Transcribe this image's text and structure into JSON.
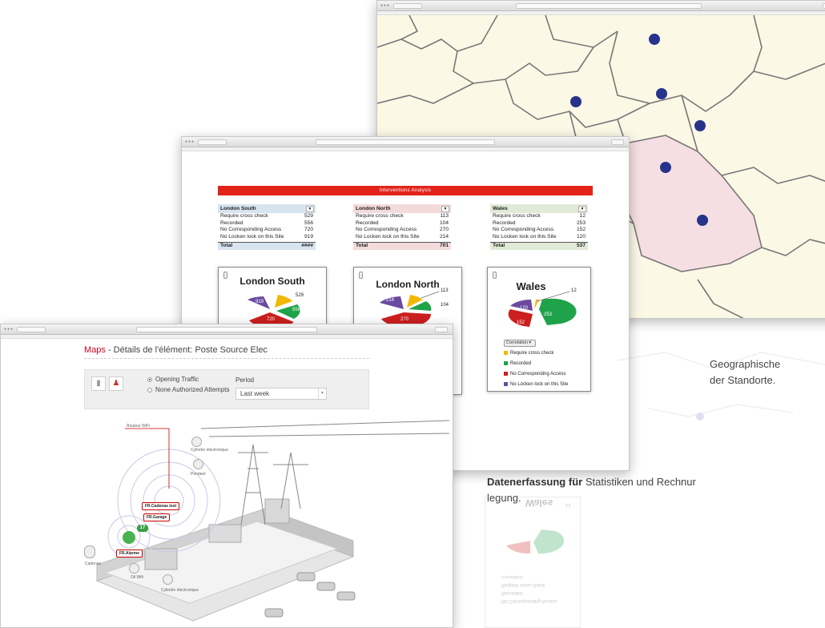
{
  "analysis": {
    "banner": "Interventions Analysis",
    "total_label": "Total",
    "tables": [
      {
        "name": "London South",
        "color": "#d8e4f0",
        "rows": [
          [
            "Require cross check",
            "529"
          ],
          [
            "Recorded",
            "556"
          ],
          [
            "No Corresponding Access",
            "720"
          ],
          [
            "No Locken lock on this Site",
            "919"
          ]
        ],
        "total": "####"
      },
      {
        "name": "London North",
        "color": "#f3dadb",
        "rows": [
          [
            "Require cross check",
            "113"
          ],
          [
            "Recorded",
            "104"
          ],
          [
            "No Corresponding Access",
            "270"
          ],
          [
            "No Locken lock on this Site",
            "214"
          ]
        ],
        "total": "701"
      },
      {
        "name": "Wales",
        "color": "#e1ead6",
        "rows": [
          [
            "Require cross check",
            "12"
          ],
          [
            "Recorded",
            "253"
          ],
          [
            "No Corresponding Access",
            "152"
          ],
          [
            "No Locken lock on this Site",
            "120"
          ]
        ],
        "total": "537"
      }
    ],
    "cards": [
      {
        "title": "London South",
        "labels": [
          "529",
          "556",
          "720",
          "919"
        ]
      },
      {
        "title": "London North",
        "labels": [
          "113",
          "104",
          "270",
          "214"
        ]
      },
      {
        "title": "Wales",
        "labels": [
          "12",
          "253",
          "152",
          "120"
        ]
      }
    ],
    "correlation": "Correlation",
    "legend": [
      {
        "label": "Require cross check",
        "color": "#f2b800"
      },
      {
        "label": "Recorded",
        "color": "#1fa34a"
      },
      {
        "label": "No Corresponding Access",
        "color": "#cc1f1f"
      },
      {
        "label": "No Locken lock on this Site",
        "color": "#6a4ba0"
      }
    ]
  },
  "maps": {
    "title_red": "Maps",
    "title_rest": " - Détails de l'élément: Poste Source Elec",
    "radio1": "Opening Traffic",
    "radio2": "None Authorized Attempts",
    "period_label": "Period",
    "period_value": "Last week",
    "tags": [
      "FR.Cadenas test",
      "FR.Garage",
      "FR.Alarme"
    ],
    "badge": "17",
    "labels": {
      "router": "Routeur WiFi",
      "cyl1": "Cylindre électronique",
      "pendant": "Pendant",
      "cad": "Cadenas",
      "oil": "Oil Wifi",
      "cyl2": "Cylindre électronique"
    }
  },
  "text": {
    "geo1": "Geographische",
    "geo2": "der Standorte.",
    "data_bold": "Datenerfassung für",
    "data_rest": " Statistiken und Rechnur",
    "data_line2": "legung."
  },
  "reflection": {
    "title": "Wales",
    "rows": [
      "No Corresponding Access",
      "Recorded",
      "Require cross check"
    ],
    "corr": "Correlation",
    "val": "12"
  }
}
